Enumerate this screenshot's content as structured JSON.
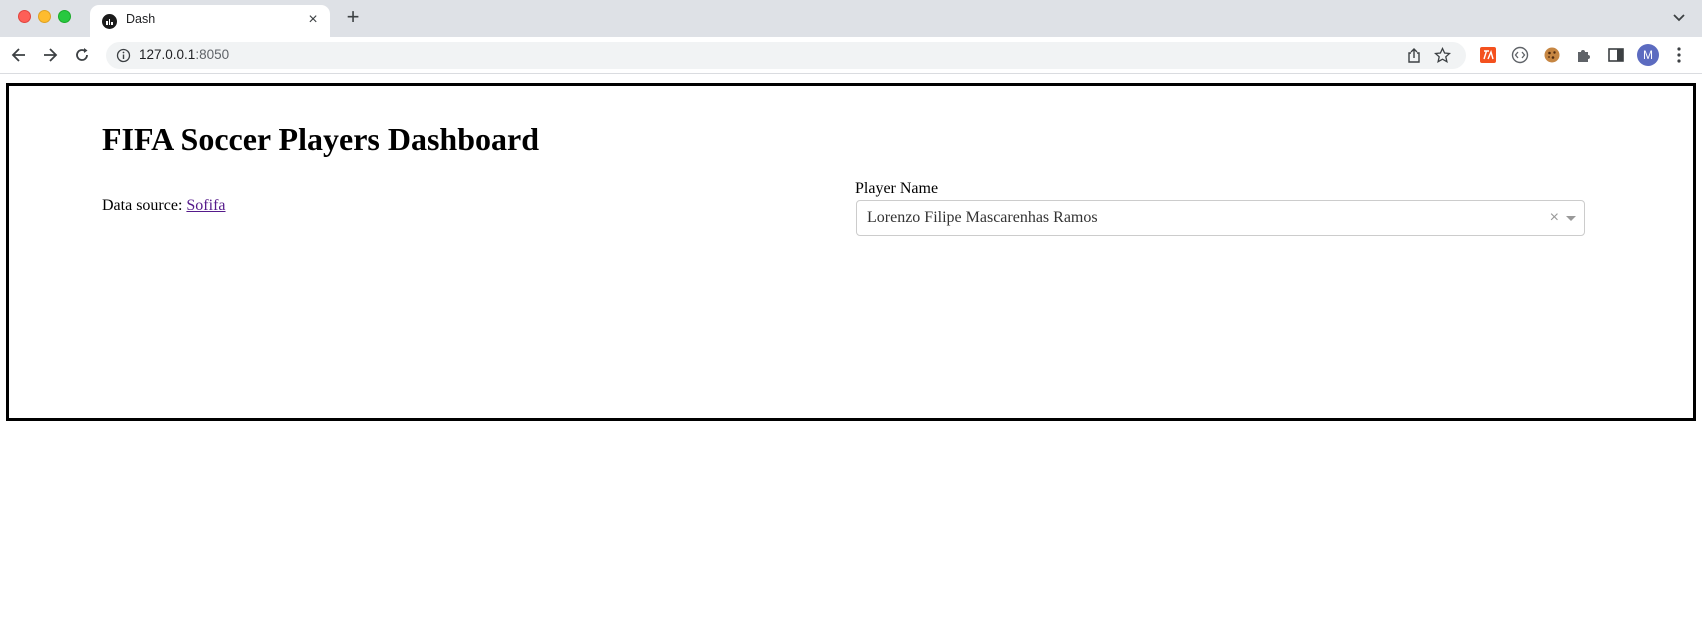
{
  "browser": {
    "tab": {
      "title": "Dash"
    },
    "url": {
      "host": "127.0.0.1",
      "port": ":8050"
    },
    "profile_initial": "M"
  },
  "page": {
    "title": "FIFA Soccer Players Dashboard",
    "data_source_prefix": "Data source: ",
    "data_source_link": "Sofifa",
    "player_field": {
      "label": "Player Name",
      "value": "Lorenzo Filipe Mascarenhas Ramos"
    }
  },
  "colors": {
    "link": "#551a8b",
    "frame_border": "#000000"
  }
}
